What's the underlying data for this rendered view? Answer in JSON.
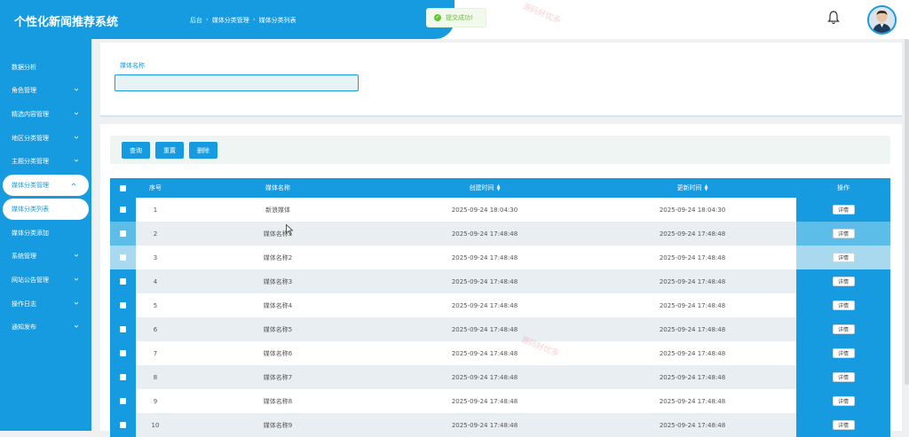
{
  "app": {
    "title": "个性化新闻推荐系统"
  },
  "breadcrumb": [
    "后台",
    "媒体分类管理",
    "媒体分类列表"
  ],
  "toast": {
    "text": "提交成功!"
  },
  "watermark": {
    "text": "源码好优多"
  },
  "sidebar": {
    "items": [
      {
        "label": "数据分析",
        "has_arrow": false
      },
      {
        "label": "角色管理",
        "has_arrow": true
      },
      {
        "label": "精选内容管理",
        "has_arrow": true
      },
      {
        "label": "地区分类管理",
        "has_arrow": true
      },
      {
        "label": "主题分类管理",
        "has_arrow": true
      },
      {
        "label": "媒体分类管理",
        "has_arrow": true,
        "open": true
      },
      {
        "label": "媒体分类列表",
        "sub": true,
        "active": true
      },
      {
        "label": "媒体分类添加",
        "sub": true
      },
      {
        "label": "系统管理",
        "has_arrow": true
      },
      {
        "label": "网站公告管理",
        "has_arrow": true
      },
      {
        "label": "操作日志",
        "has_arrow": true
      },
      {
        "label": "通知发布",
        "has_arrow": true
      }
    ]
  },
  "search": {
    "label": "媒体名称",
    "value": "",
    "placeholder": ""
  },
  "buttons": {
    "query": "查询",
    "reset": "重置",
    "delete": "删除"
  },
  "table": {
    "headers": {
      "index": "序号",
      "name": "媒体名称",
      "created": "创建时间",
      "updated": "更新时间",
      "action": "操作"
    },
    "detail_label": "详情",
    "rows": [
      {
        "index": "1",
        "name": "新浪媒体",
        "created": "2025-09-24 18:04:30",
        "updated": "2025-09-24 18:04:30"
      },
      {
        "index": "2",
        "name": "媒体名称1",
        "created": "2025-09-24 17:48:48",
        "updated": "2025-09-24 17:48:48"
      },
      {
        "index": "3",
        "name": "媒体名称2",
        "created": "2025-09-24 17:48:48",
        "updated": "2025-09-24 17:48:48"
      },
      {
        "index": "4",
        "name": "媒体名称3",
        "created": "2025-09-24 17:48:48",
        "updated": "2025-09-24 17:48:48"
      },
      {
        "index": "5",
        "name": "媒体名称4",
        "created": "2025-09-24 17:48:48",
        "updated": "2025-09-24 17:48:48"
      },
      {
        "index": "6",
        "name": "媒体名称5",
        "created": "2025-09-24 17:48:48",
        "updated": "2025-09-24 17:48:48"
      },
      {
        "index": "7",
        "name": "媒体名称6",
        "created": "2025-09-24 17:48:48",
        "updated": "2025-09-24 17:48:48"
      },
      {
        "index": "8",
        "name": "媒体名称7",
        "created": "2025-09-24 17:48:48",
        "updated": "2025-09-24 17:48:48"
      },
      {
        "index": "9",
        "name": "媒体名称8",
        "created": "2025-09-24 17:48:48",
        "updated": "2025-09-24 17:48:48"
      },
      {
        "index": "10",
        "name": "媒体名称9",
        "created": "2025-09-24 17:48:48",
        "updated": "2025-09-24 17:48:48"
      }
    ]
  },
  "colors": {
    "accent": "#169ae0",
    "row_alt": "#e9eef2",
    "row": "#ffffff",
    "hover": "#5bbde8",
    "hover_light": "#a9d9ef"
  }
}
